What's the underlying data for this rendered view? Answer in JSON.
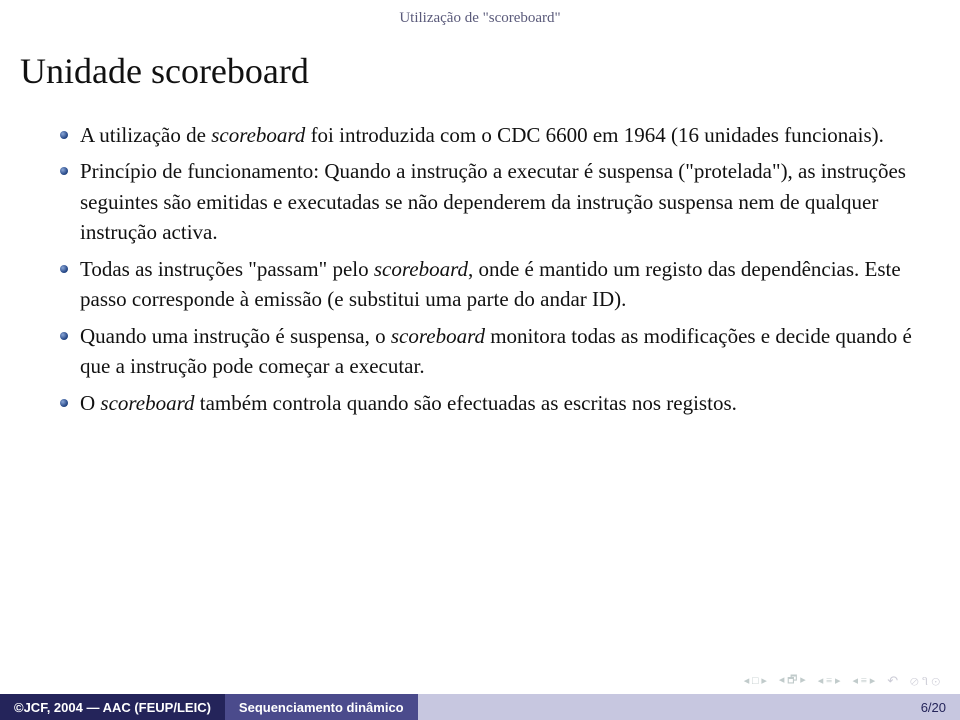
{
  "section_label": "Utilização de \"scoreboard\"",
  "title": "Unidade scoreboard",
  "bullets": [
    {
      "pre": "A utilização de ",
      "it1": "scoreboard",
      "post": " foi introduzida com o CDC 6600 em 1964 (16 unidades funcionais)."
    },
    {
      "text": "Princípio de funcionamento: Quando a instrução a executar é suspensa (\"protelada\"), as instruções seguintes são emitidas e executadas se não dependerem da instrução suspensa nem de qualquer instrução activa."
    },
    {
      "pre": "Todas as instruções \"passam\" pelo ",
      "it1": "scoreboard",
      "post": ", onde é mantido um registo das dependências. Este passo corresponde à emissão (e substitui uma parte do andar ID)."
    },
    {
      "pre": "Quando uma instrução é suspensa, o ",
      "it1": "scoreboard",
      "post": " monitora todas as modificações e decide quando é que a instrução pode começar a executar."
    },
    {
      "pre": "O ",
      "it1": "scoreboard",
      "post": " também controla quando são efectuadas as escritas nos registos."
    }
  ],
  "footer": {
    "left": "©JCF, 2004 — AAC (FEUP/LEIC)",
    "mid": "Sequenciamento dinâmico",
    "right": "6/20"
  }
}
